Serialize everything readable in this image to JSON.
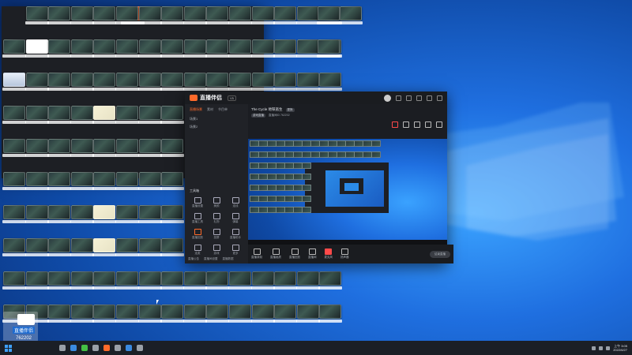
{
  "app": {
    "logo_text": "直播伴侣",
    "version_label": "V5",
    "left_tabs": [
      "直播场景",
      "素材",
      "节目单"
    ],
    "scenes": [
      "场景1",
      "场景2"
    ],
    "tools_title": "工具箱",
    "tools": [
      "直播设置",
      "美颜",
      "连线",
      "直播工具",
      "礼物",
      "弹幕",
      "直播回放",
      "投屏",
      "直播助手",
      "连麦",
      "游戏",
      "更多"
    ],
    "left_footer": [
      "直播公告",
      "直播间设置",
      "直播数据"
    ],
    "stream_title": "The Cycle 地铁逃生",
    "stream_badge": "更换",
    "category": "游戏直播",
    "sub_info": "直播间ID 762202",
    "controls": [
      "直播录制",
      "直播画质",
      "直播回放",
      "直播间",
      "麦克风",
      "扬声器"
    ],
    "live_button": "结束直播"
  },
  "watermark": {
    "name": "直播伴侣",
    "id": "762202"
  },
  "taskbar": {
    "time": "上午 3:05",
    "date": "2022/6/27"
  }
}
